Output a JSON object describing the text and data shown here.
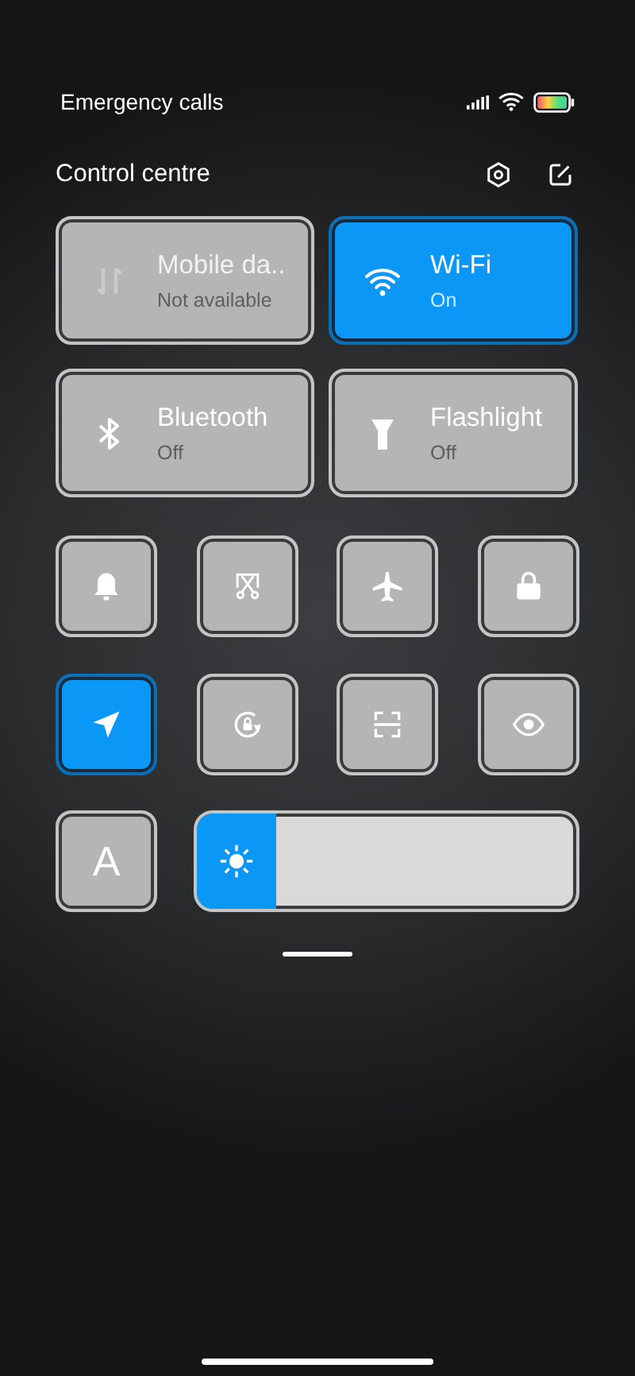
{
  "status_bar": {
    "carrier": "Emergency calls"
  },
  "header": {
    "title": "Control centre"
  },
  "large_tiles": [
    {
      "kind": "mobile-data",
      "label": "Mobile da..",
      "status": "Not available",
      "on": false,
      "disabled": true
    },
    {
      "kind": "wifi",
      "label": "Wi-Fi",
      "status": "On",
      "on": true,
      "disabled": false
    },
    {
      "kind": "bluetooth",
      "label": "Bluetooth",
      "status": "Off",
      "on": false,
      "disabled": false
    },
    {
      "kind": "flashlight",
      "label": "Flashlight",
      "status": "Off",
      "on": false,
      "disabled": false
    }
  ],
  "small_tiles": [
    {
      "kind": "bell",
      "on": false
    },
    {
      "kind": "scissors",
      "on": false
    },
    {
      "kind": "airplane",
      "on": false
    },
    {
      "kind": "lock",
      "on": false
    },
    {
      "kind": "location",
      "on": true
    },
    {
      "kind": "rotation-lock",
      "on": false
    },
    {
      "kind": "scan",
      "on": false
    },
    {
      "kind": "eye",
      "on": false
    }
  ],
  "auto_brightness": {
    "glyph": "A",
    "on": false
  },
  "brightness": {
    "level": 0.21
  }
}
